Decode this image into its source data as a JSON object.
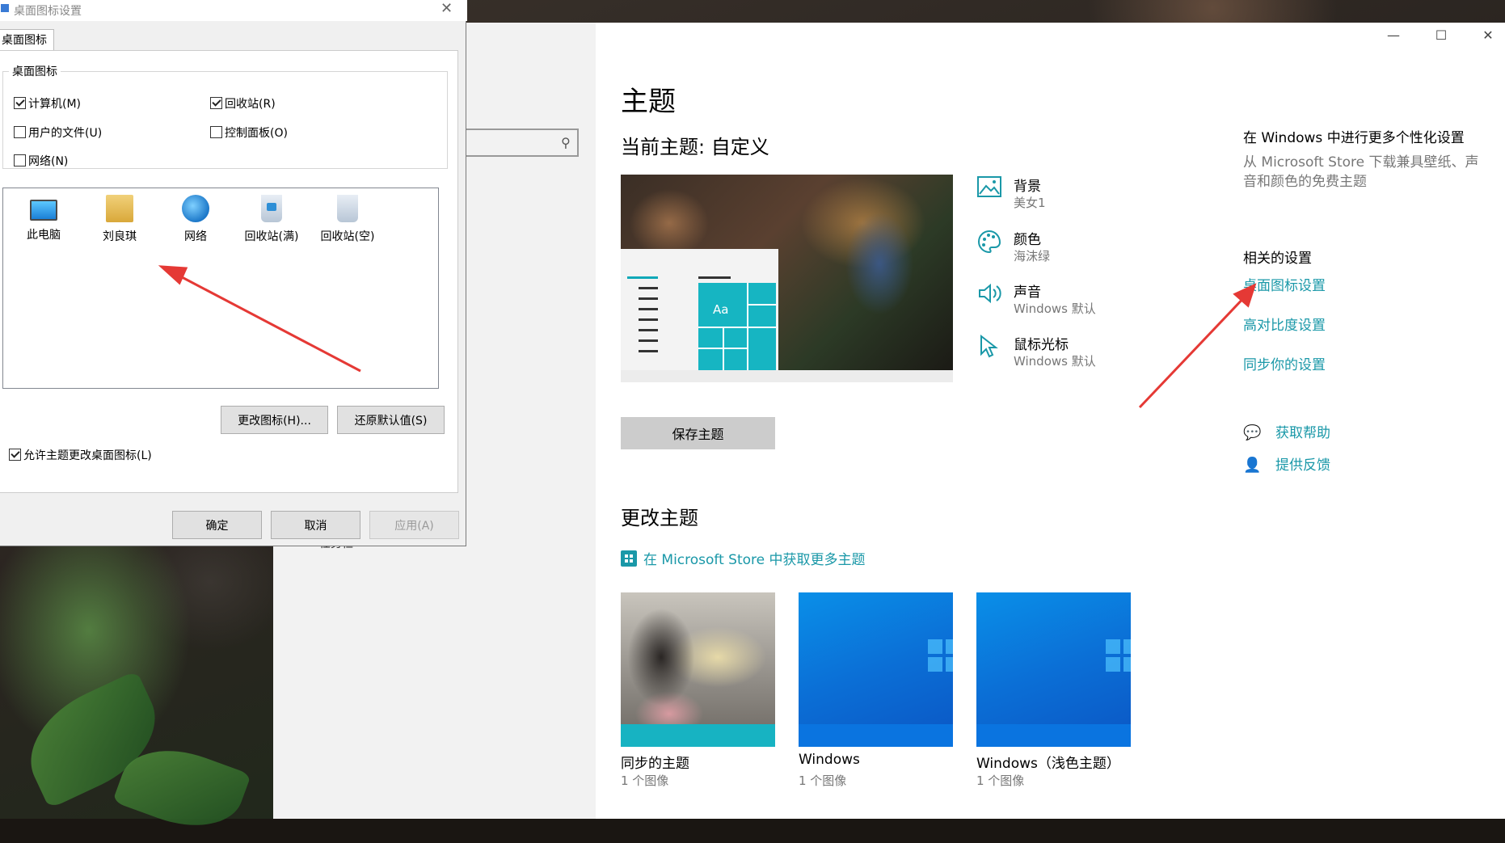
{
  "settings": {
    "window_controls": {
      "minimize": "—",
      "maximize": "☐",
      "close": "✕"
    },
    "nav_snippet": "任务栏",
    "page_title": "主题",
    "current_theme_label": "当前主题: 自定义",
    "properties": [
      {
        "name": "背景",
        "value": "美女1",
        "icon": "picture-icon"
      },
      {
        "name": "颜色",
        "value": "海沫绿",
        "icon": "palette-icon"
      },
      {
        "name": "声音",
        "value": "Windows 默认",
        "icon": "speaker-icon"
      },
      {
        "name": "鼠标光标",
        "value": "Windows 默认",
        "icon": "cursor-icon"
      }
    ],
    "preview": {
      "tile_text": "Aa"
    },
    "save_theme_button": "保存主题",
    "change_theme_heading": "更改主题",
    "store_link": "在 Microsoft Store 中获取更多主题",
    "themes": [
      {
        "name": "同步的主题",
        "count": "1 个图像"
      },
      {
        "name": "Windows",
        "count": "1 个图像"
      },
      {
        "name": "Windows（浅色主题）",
        "count": "1 个图像"
      }
    ],
    "sidebar": {
      "more_heading": "在 Windows 中进行更多个性化设置",
      "more_text": "从 Microsoft Store 下载兼具壁纸、声音和颜色的免费主题",
      "related_heading": "相关的设置",
      "related_links": [
        "桌面图标设置",
        "高对比度设置",
        "同步你的设置"
      ],
      "help": "获取帮助",
      "feedback": "提供反馈"
    },
    "accent_color": "#1a98a8"
  },
  "dialog": {
    "title": "桌面图标设置",
    "tab": "桌面图标",
    "group_label": "桌面图标",
    "checkboxes": [
      {
        "label": "计算机(M)",
        "checked": true
      },
      {
        "label": "回收站(R)",
        "checked": true
      },
      {
        "label": "用户的文件(U)",
        "checked": false
      },
      {
        "label": "控制面板(O)",
        "checked": false
      },
      {
        "label": "网络(N)",
        "checked": false
      }
    ],
    "icons": [
      "此电脑",
      "刘良琪",
      "网络",
      "回收站(满)",
      "回收站(空)"
    ],
    "change_icon_button": "更改图标(H)...",
    "restore_default_button": "还原默认值(S)",
    "allow_themes_label": "允许主题更改桌面图标(L)",
    "allow_themes_checked": true,
    "ok_button": "确定",
    "cancel_button": "取消",
    "apply_button": "应用(A)"
  },
  "annotation_color": "#e53935"
}
